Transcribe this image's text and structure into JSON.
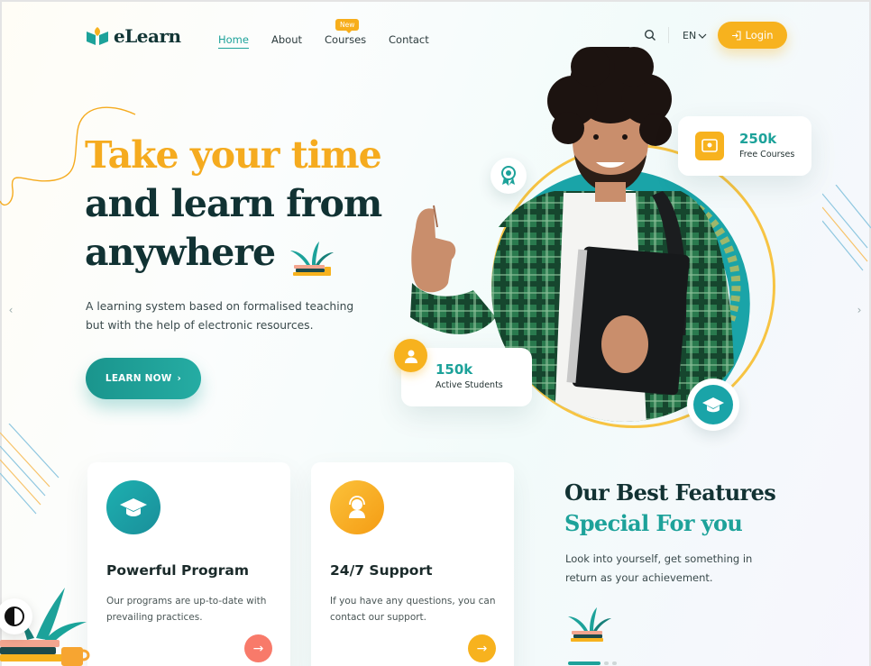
{
  "brand": {
    "name": "eLearn"
  },
  "nav": {
    "items": [
      {
        "label": "Home",
        "active": true
      },
      {
        "label": "About"
      },
      {
        "label": "Courses",
        "badge": "New"
      },
      {
        "label": "Contact"
      }
    ],
    "language": "EN",
    "login_label": "Login"
  },
  "hero": {
    "title_line1": "Take your time",
    "title_line2": "and learn from",
    "title_line3": "anywhere",
    "description": "A learning system based on formalised teaching but with the help of electronic resources.",
    "cta_label": "LEARN NOW"
  },
  "stats": {
    "courses": {
      "value": "250k",
      "label": "Free Courses"
    },
    "students": {
      "value": "150k",
      "label": "Active Students"
    }
  },
  "features": {
    "cards": [
      {
        "title": "Powerful Program",
        "description": "Our programs are up-to-date with prevailing practices."
      },
      {
        "title": "24/7 Support",
        "description": "If you have any questions, you can contact our support."
      }
    ],
    "heading_line1": "Our Best Features",
    "heading_line2": "Special For you",
    "description": "Look into yourself, get something in return as your achievement."
  },
  "colors": {
    "accent": "#1da29a",
    "brand_yellow": "#f7b21e",
    "dark": "#123233",
    "coral": "#f87a6a"
  }
}
